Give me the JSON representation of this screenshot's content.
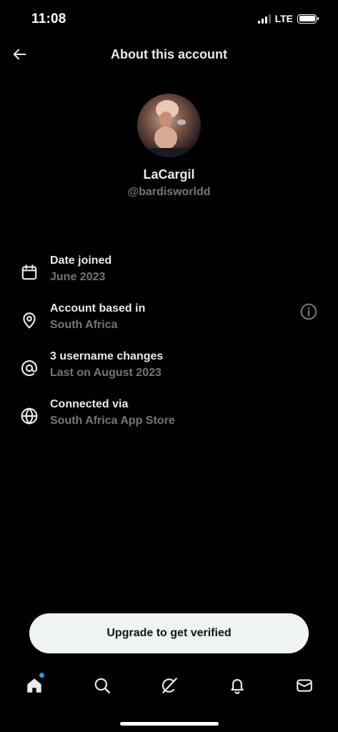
{
  "status_bar": {
    "time": "11:08",
    "network": "LTE"
  },
  "header": {
    "title": "About this account",
    "back_icon": "arrow-left-icon"
  },
  "profile": {
    "display_name": "LaCargil",
    "handle": "@bardisworldd"
  },
  "info_rows": [
    {
      "icon": "calendar-icon",
      "title": "Date joined",
      "subtitle": "June 2023"
    },
    {
      "icon": "location-pin-icon",
      "title": "Account based in",
      "subtitle": "South Africa",
      "action_icon": "info-circle-icon"
    },
    {
      "icon": "at-sign-icon",
      "title": "3 username changes",
      "subtitle": "Last on August 2023"
    },
    {
      "icon": "globe-icon",
      "title": "Connected via",
      "subtitle": "South Africa App Store"
    }
  ],
  "upgrade_button": {
    "label": "Upgrade to get verified"
  },
  "bottom_nav": [
    {
      "icon": "home-icon",
      "active": true,
      "has_notification_dot": true
    },
    {
      "icon": "search-icon"
    },
    {
      "icon": "grok-icon"
    },
    {
      "icon": "bell-icon"
    },
    {
      "icon": "mail-icon"
    }
  ],
  "colors": {
    "background": "#000000",
    "primary_text": "#e7e9ea",
    "secondary_text": "#71767b",
    "button_bg": "#eff3f4",
    "button_text": "#0f1419",
    "accent": "#1d9bf0"
  }
}
